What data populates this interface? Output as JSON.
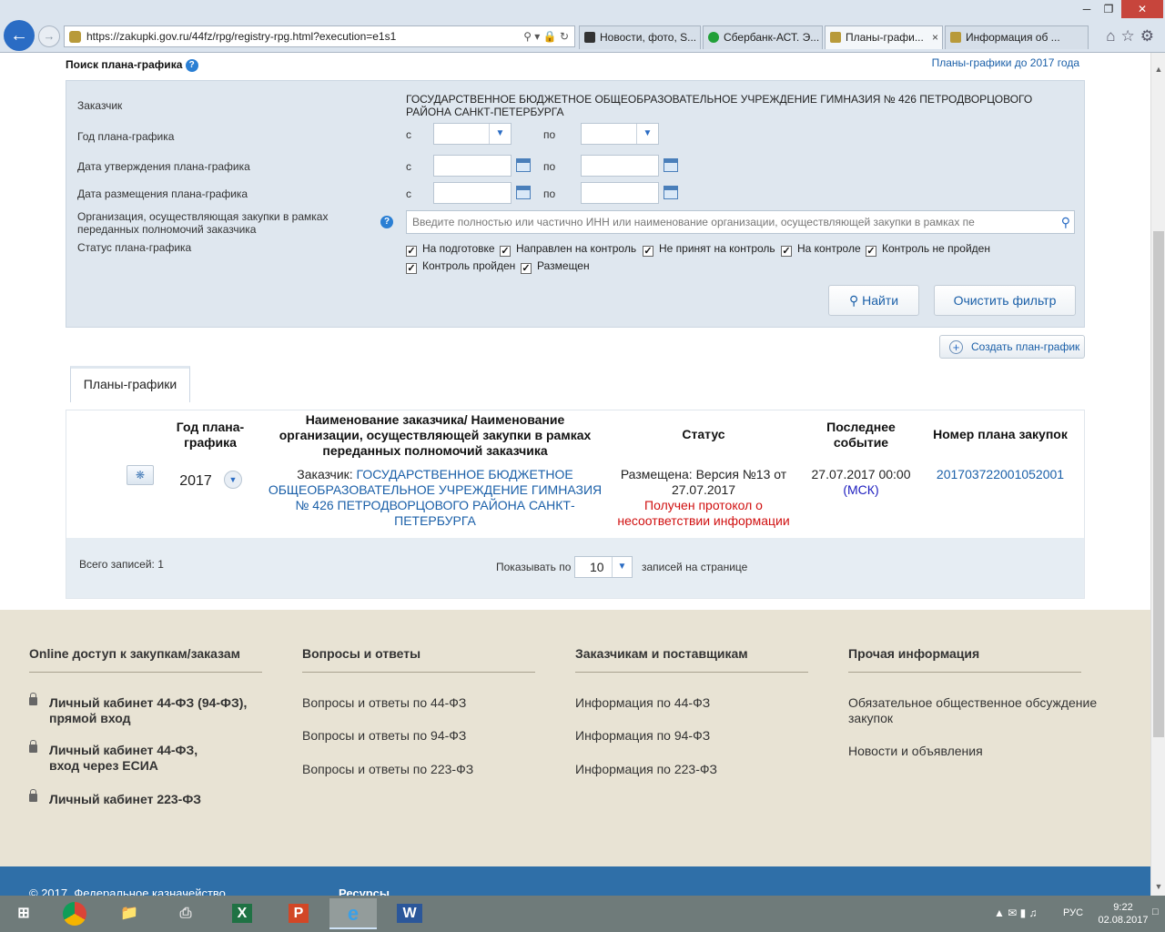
{
  "browser": {
    "url": "https://zakupki.gov.ru/44fz/rpg/registry-rpg.html?execution=e1s1",
    "tabs": [
      {
        "title": "Новости, фото, S...",
        "active": false,
        "icon_color": "#333333"
      },
      {
        "title": "Сбербанк-АСТ. Э...",
        "active": false,
        "icon_color": "#21a038"
      },
      {
        "title": "Планы-графи...",
        "active": true,
        "icon_color": "#b89a3a"
      },
      {
        "title": "Информация об ...",
        "active": false,
        "icon_color": "#b89a3a"
      }
    ],
    "window_buttons": [
      "─",
      "❐",
      "✕"
    ]
  },
  "search": {
    "title": "Поиск плана-графика",
    "help_glyph": "?",
    "plans_before_2017_link": "Планы-графики до 2017 года",
    "customer_label": "Заказчик",
    "customer_value": "ГОСУДАРСТВЕННОЕ БЮДЖЕТНОЕ ОБЩЕОБРАЗОВАТЕЛЬНОЕ УЧРЕЖДЕНИЕ ГИМНАЗИЯ № 426 ПЕТРОДВОРЦОВОГО РАЙОНА САНКТ-ПЕТЕРБУРГА",
    "year_label": "Год плана-графика",
    "approval_date_label": "Дата утверждения плана-графика",
    "placement_date_label": "Дата размещения плана-графика",
    "from": "с",
    "to": "по",
    "org_label": "Организация, осуществляющая закупки в рамках переданных полномочий заказчика",
    "org_placeholder": "Введите полностью или частично ИНН или наименование организации, осуществляющей закупки в рамках пе",
    "status_label": "Статус плана-графика",
    "statuses": [
      {
        "label": "На подготовке",
        "checked": true
      },
      {
        "label": "Направлен на контроль",
        "checked": true
      },
      {
        "label": "Не принят на контроль",
        "checked": true
      },
      {
        "label": "На контроле",
        "checked": true
      },
      {
        "label": "Контроль не пройден",
        "checked": true
      },
      {
        "label": "Контроль пройден",
        "checked": true
      },
      {
        "label": "Размещен",
        "checked": true
      }
    ],
    "find_button": "Найти",
    "clear_button": "Очистить фильтр",
    "create_button": "Создать план-график"
  },
  "results": {
    "tab_label": "Планы-графики",
    "columns": {
      "year": "Год плана-графика",
      "name": "Наименование заказчика/ Наименование организации, осуществляющей закупки в рамках переданных полномочий заказчика",
      "status": "Статус",
      "last_event": "Последнее событие",
      "plan_number": "Номер плана закупок"
    },
    "row": {
      "year": "2017",
      "customer_prefix": "Заказчик: ",
      "customer_name": "ГОСУДАРСТВЕННОЕ БЮДЖЕТНОЕ ОБЩЕОБРАЗОВАТЕЛЬНОЕ УЧРЕЖДЕНИЕ ГИМНАЗИЯ № 426 ПЕТРОДВОРЦОВОГО РАЙОНА САНКТ-ПЕТЕРБУРГА",
      "status": "Размещена: Версия №13 от 27.07.2017",
      "status_warning": "Получен протокол о несоответствии информации",
      "last_event_time": "27.07.2017 00:00",
      "last_event_tz": "(МСК)",
      "plan_number": "201703722001052001"
    },
    "total": "Всего записей: 1",
    "show_by": "Показывать по",
    "page_size": "10",
    "per_page": "записей на странице"
  },
  "footer": {
    "columns": [
      {
        "title": "Online доступ к закупкам/заказам",
        "links": [
          "Личный кабинет 44-ФЗ (94-ФЗ), прямой вход",
          "Личный кабинет 44-ФЗ, вход через ЕСИА",
          "Личный кабинет 223-ФЗ"
        ]
      },
      {
        "title": "Вопросы и ответы",
        "links": [
          "Вопросы и ответы по 44-ФЗ",
          "Вопросы и ответы по 94-ФЗ",
          "Вопросы и ответы по 223-ФЗ"
        ]
      },
      {
        "title": "Заказчикам и поставщикам",
        "links": [
          "Информация по 44-ФЗ",
          "Информация по 94-ФЗ",
          "Информация по 223-ФЗ"
        ]
      },
      {
        "title": "Прочая информация",
        "links": [
          "Обязательное общественное обсуждение закупок",
          "Новости и объявления"
        ]
      }
    ],
    "copyright": "© 2017. Федеральное казначейство",
    "resources": "Ресурсы"
  },
  "taskbar": {
    "language": "РУС",
    "time": "9:22",
    "date": "02.08.2017",
    "apps": [
      "windows-start",
      "chrome",
      "file-explorer",
      "scanner",
      "excel",
      "powerpoint",
      "internet-explorer",
      "word"
    ]
  }
}
